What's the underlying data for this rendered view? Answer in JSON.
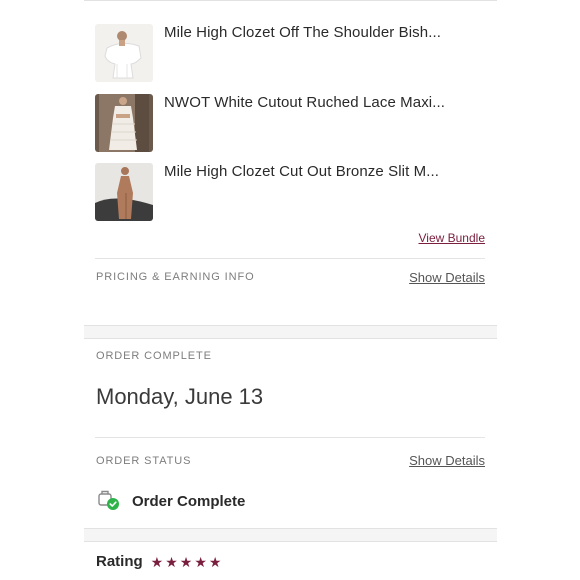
{
  "bundle": {
    "items": [
      {
        "title": "Mile High Clozet Off The Shoulder Bish..."
      },
      {
        "title": "NWOT White Cutout Ruched Lace Maxi..."
      },
      {
        "title": "Mile High Clozet Cut Out Bronze Slit M..."
      }
    ],
    "view_bundle_label": "View Bundle"
  },
  "pricing": {
    "label": "PRICING & EARNING INFO",
    "show_details_label": "Show Details"
  },
  "order_complete": {
    "label": "ORDER COMPLETE",
    "date": "Monday, June 13"
  },
  "order_status": {
    "label": "ORDER STATUS",
    "show_details_label": "Show Details",
    "status_text": "Order Complete",
    "status_color": "#2db34a"
  },
  "rating": {
    "label": "Rating",
    "stars": 5,
    "star_glyph": "★",
    "star_color": "#7a1f3d"
  }
}
